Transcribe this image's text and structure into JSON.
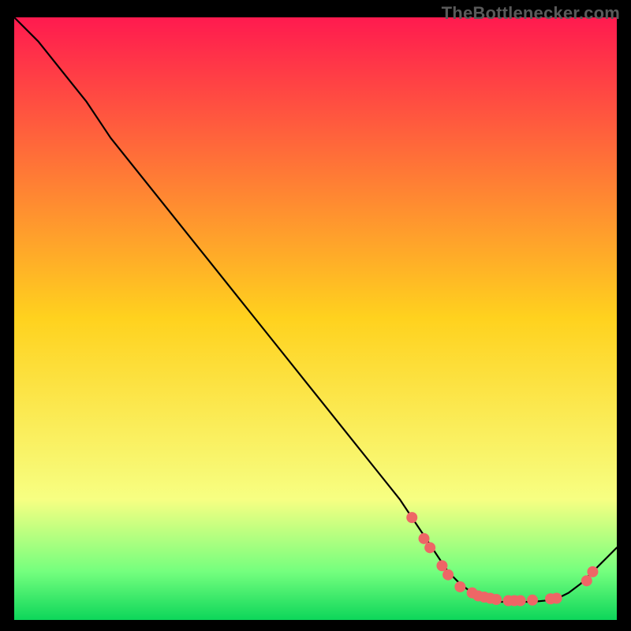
{
  "watermark": {
    "text": "TheBottlenecker.com"
  },
  "colors": {
    "bg": "#000000",
    "watermark": "#5a5a5a",
    "line": "#000000",
    "marker_fill": "#ee6666",
    "marker_stroke": "#c94d4d",
    "grad_top": "#ff1a4f",
    "grad_mid": "#ffd21e",
    "grad_band_top": "#f7ff82",
    "grad_band_bot": "#74ff7e",
    "grad_bottom": "#0dd65a"
  },
  "chart_data": {
    "type": "line",
    "title": "",
    "xlabel": "",
    "ylabel": "",
    "xlim": [
      0,
      100
    ],
    "ylim": [
      0,
      100
    ],
    "series": [
      {
        "name": "curve",
        "x": [
          0,
          4,
          8,
          12,
          16,
          24,
          32,
          40,
          48,
          56,
          60,
          64,
          68,
          70,
          72,
          74,
          76,
          78,
          80,
          82,
          84,
          86,
          88,
          90,
          92,
          94,
          96,
          98,
          100
        ],
        "y": [
          100,
          96,
          91,
          86,
          80,
          70,
          60,
          50,
          40,
          30,
          25,
          20,
          14,
          11,
          8,
          6,
          4.5,
          3.5,
          3,
          3,
          3,
          3,
          3.2,
          3.5,
          4.5,
          6,
          8,
          10,
          12
        ]
      }
    ],
    "markers": {
      "name": "points",
      "x": [
        66,
        68,
        69,
        71,
        72,
        74,
        76,
        77,
        78,
        79,
        80,
        82,
        83,
        84,
        86,
        89,
        90,
        95,
        96
      ],
      "y": [
        17,
        13.5,
        12,
        9,
        7.5,
        5.5,
        4.5,
        4,
        3.8,
        3.6,
        3.4,
        3.2,
        3.2,
        3.2,
        3.3,
        3.5,
        3.6,
        6.5,
        8
      ]
    }
  }
}
